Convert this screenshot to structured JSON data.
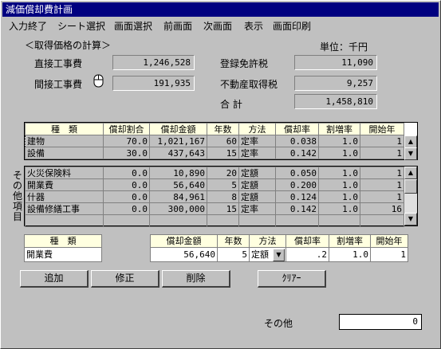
{
  "window": {
    "title": "減価償却費計画"
  },
  "menu": [
    "入力終了",
    "シート選択",
    "画面選択",
    "前画面",
    "次画面",
    "表示",
    "画面印刷"
  ],
  "section": {
    "title": "＜取得価格の計算＞",
    "unit": "単位：千円"
  },
  "acquisition": {
    "direct_label": "直接工事費",
    "direct_value": "1,246,528",
    "indirect_label": "間接工事費",
    "indirect_value": "191,935",
    "reg_tax_label": "登録免許税",
    "reg_tax_value": "11,090",
    "re_tax_label": "不動産取得税",
    "re_tax_value": "9,257",
    "total_label": "合 計",
    "total_value": "1,458,810"
  },
  "table1": {
    "headers": [
      "種　類",
      "償却割合",
      "償却金額",
      "年数",
      "方法",
      "償却率",
      "割増率",
      "開始年"
    ],
    "rows": [
      [
        "建物",
        "70.0",
        "1,021,167",
        "60",
        "定率",
        "0.038",
        "1.0",
        "1"
      ],
      [
        "設備",
        "30.0",
        "437,643",
        "15",
        "定率",
        "0.142",
        "1.0",
        "1"
      ]
    ]
  },
  "table2": {
    "side_label": [
      "そ",
      "の",
      "他",
      "項",
      "目"
    ],
    "rows": [
      [
        "火災保険料",
        "0.0",
        "10,890",
        "20",
        "定額",
        "0.050",
        "1.0",
        "1"
      ],
      [
        "開業費",
        "0.0",
        "56,640",
        "5",
        "定額",
        "0.200",
        "1.0",
        "1"
      ],
      [
        "什器",
        "0.0",
        "84,961",
        "8",
        "定額",
        "0.124",
        "1.0",
        "1"
      ],
      [
        "設備修繕工事",
        "0.0",
        "300,000",
        "15",
        "定率",
        "0.142",
        "1.0",
        "16"
      ],
      [
        "",
        "",
        "",
        "",
        "",
        "",
        "",
        ""
      ]
    ]
  },
  "edit": {
    "headers": {
      "kind": "種　類",
      "amount": "償却金額",
      "years": "年数",
      "method": "方法",
      "rate": "償却率",
      "premium": "割増率",
      "start": "開始年"
    },
    "kind": "開業費",
    "amount": "56,640",
    "years": "5",
    "method": "定額",
    "rate": ".2",
    "premium": "1.0",
    "start": "1"
  },
  "buttons": {
    "add": "追加",
    "modify": "修正",
    "delete": "削除",
    "clear": "ｸﾘｱｰ"
  },
  "other": {
    "label": "その他",
    "value": "0"
  }
}
